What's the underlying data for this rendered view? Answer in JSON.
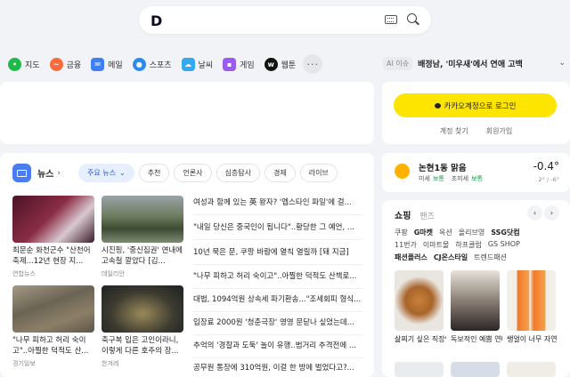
{
  "search": {
    "logo": "D",
    "placeholder": ""
  },
  "shortcuts": [
    {
      "label": "지도",
      "icon": "map-icon",
      "color": "#1fb94a"
    },
    {
      "label": "금융",
      "icon": "finance-icon",
      "color": "#ff6a3d"
    },
    {
      "label": "메일",
      "icon": "mail-icon",
      "color": "#3e7ff5"
    },
    {
      "label": "스포츠",
      "icon": "sports-icon",
      "color": "#2b8bf2"
    },
    {
      "label": "날씨",
      "icon": "weather-icon",
      "color": "#34a8f0"
    },
    {
      "label": "게임",
      "icon": "game-icon",
      "color": "#9a5cf0"
    },
    {
      "label": "웹툰",
      "icon": "webtoon-icon",
      "color": "#111111"
    }
  ],
  "issue": {
    "tag": "AI 이슈",
    "text": "배정남, '미우새'에서 연애 고백"
  },
  "login": {
    "button": "카카오계정으로 로그인",
    "find": "계정 찾기",
    "signup": "회원가입"
  },
  "news": {
    "title": "뉴스",
    "tabs": [
      "주요 뉴스",
      "추천",
      "언론사",
      "심층탐사",
      "경제",
      "라이브"
    ],
    "thumbs": [
      {
        "caption": "최문순 화천군수 \"산천어축제...12년 현장 지...",
        "source": "연합뉴스"
      },
      {
        "caption": "시진핑, '중신집권' 연내에 고속철 깔았다 [김...",
        "source": "데일리안"
      },
      {
        "caption": "\"나무 피하고 허리 숙이고\"..아찔한 덕적도 산...",
        "source": "경기일보"
      },
      {
        "caption": "축구복 입은 고인이라니, 이렇게 다른 호주의 장...",
        "source": "한겨레"
      }
    ],
    "headlines": [
      "여성과 함께 있는 英 왕자? '엡스타인 파일'에 걸...",
      "\"내일 당신은 중국인이 됩니다\"..황당한 그 예언, ...",
      "10년 묵은 문, 쿠팡 바람에 열칙 열릴까 [돼 지금]",
      "\"나무 피하고 허리 숙이고\"..아찔한 덕적도 산책로...",
      "대법, 1094억원 상속세 파기환송...\"조세회피 형식...",
      "입장료 2000원 '청춘극장' 영영 문닫나 싶었는데...",
      "추억의 '경찰과 도둑' 놀이 유행..범거리 추격전에 ...",
      "공무원 통장에 310억원, 이걸 한 방에 벌었다고?..."
    ]
  },
  "weather": {
    "desc": "논현1동 맑음",
    "fine_dust_label": "미세",
    "fine_dust": "보통",
    "ultrafine_label": "초미세",
    "ultrafine": "보통",
    "temp": "-0.4°",
    "range": "2° / -6°"
  },
  "shopping": {
    "title": "쇼핑",
    "subtab": "팬즈",
    "malls_row1": [
      "쿠팡",
      "G마켓",
      "옥션",
      "올리브영",
      "SSG닷컴"
    ],
    "malls_row2": [
      "11번가",
      "이마트몰",
      "하프클럽",
      "GS SHOP"
    ],
    "malls_row3": [
      "패션플러스",
      "CJ온스타일",
      "트렌드패션"
    ],
    "products": [
      "삶찌기 싶은 직장인을 항...",
      "독보적인 예쁨 연대급+...",
      "쌩얼이 너무 자연 되기..."
    ]
  }
}
